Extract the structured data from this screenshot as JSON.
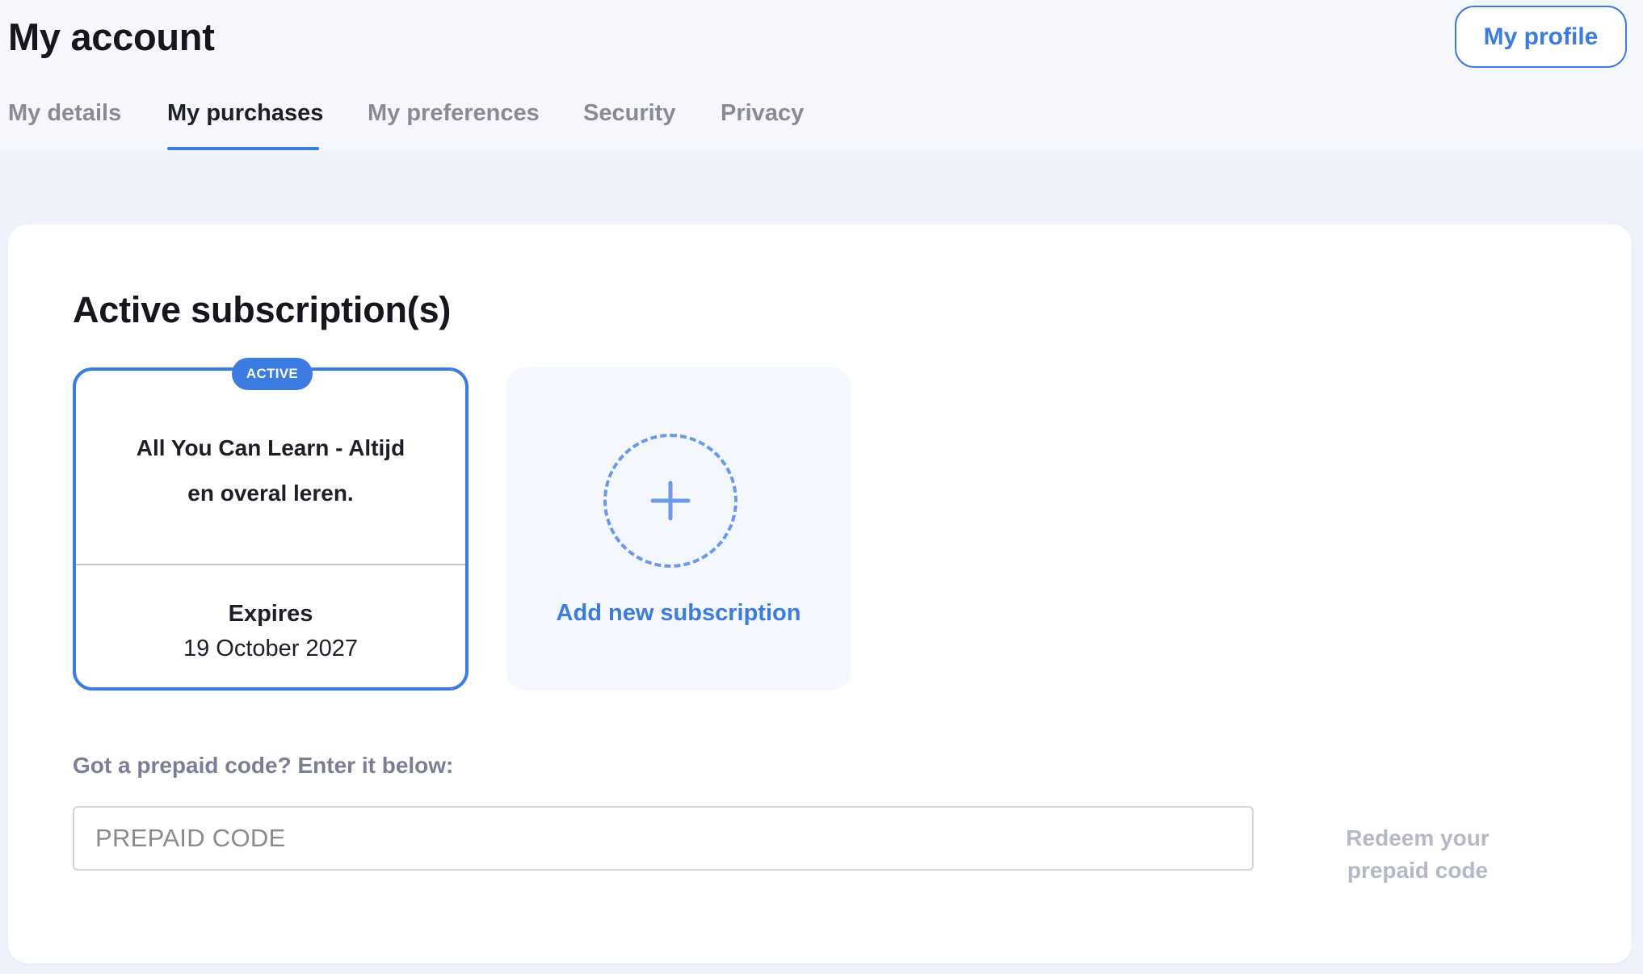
{
  "header": {
    "title": "My account",
    "profile_button": "My profile"
  },
  "tabs": [
    {
      "label": "My details",
      "active": false
    },
    {
      "label": "My purchases",
      "active": true
    },
    {
      "label": "My preferences",
      "active": false
    },
    {
      "label": "Security",
      "active": false
    },
    {
      "label": "Privacy",
      "active": false
    }
  ],
  "subscriptions": {
    "title": "Active subscription(s)",
    "items": [
      {
        "badge": "ACTIVE",
        "name": "All You Can Learn - Altijd en overal leren.",
        "expires_label": "Expires",
        "expires_date": "19 October 2027"
      }
    ],
    "add_label": "Add new subscription",
    "add_icon": "plus-icon"
  },
  "prepaid": {
    "label": "Got a prepaid code? Enter it below:",
    "value": "",
    "placeholder": "PREPAID CODE",
    "redeem_label": "Redeem your prepaid code"
  },
  "colors": {
    "accent": "#3c7be0",
    "page_background": "#eff2fb",
    "header_background": "#f5f7fd",
    "card_background": "#ffffff",
    "add_card_background": "#f4f7fd",
    "muted_label": "#7a7e96",
    "disabled_text": "#b4b8c8"
  }
}
